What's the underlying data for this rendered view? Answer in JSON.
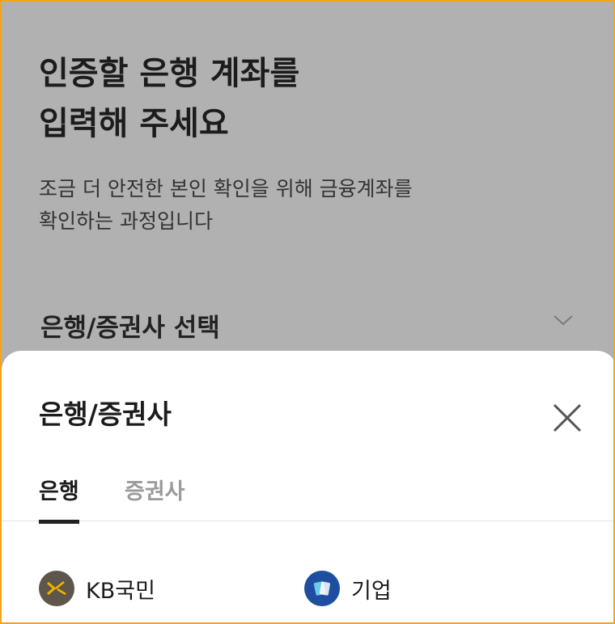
{
  "header": {
    "title_line1": "인증할 은행 계좌를",
    "title_line2": "입력해 주세요",
    "subtitle_line1": "조금 더 안전한 본인 확인을 위해 금융계좌를",
    "subtitle_line2": "확인하는 과정입니다"
  },
  "select": {
    "label": "은행/증권사 선택",
    "icon": "chevron-down-icon"
  },
  "sheet": {
    "title": "은행/증권사",
    "close_icon": "close-icon",
    "tabs": [
      {
        "label": "은행",
        "active": true
      },
      {
        "label": "증권사",
        "active": false
      }
    ],
    "banks": [
      {
        "name": "KB국민",
        "logo_color": "#5f564b",
        "logo_mark_color": "#f0b400",
        "icon": "kb-logo-icon"
      },
      {
        "name": "기업",
        "logo_color": "#1d4ea0",
        "logo_mark_color": "#6ec8e8",
        "icon": "ibk-logo-icon"
      }
    ]
  },
  "colors": {
    "overlay_bg": "#b1b1b1",
    "frame_border": "#f2a51a",
    "text_primary": "#1c1c1c",
    "tab_inactive": "#9b9b9b"
  }
}
